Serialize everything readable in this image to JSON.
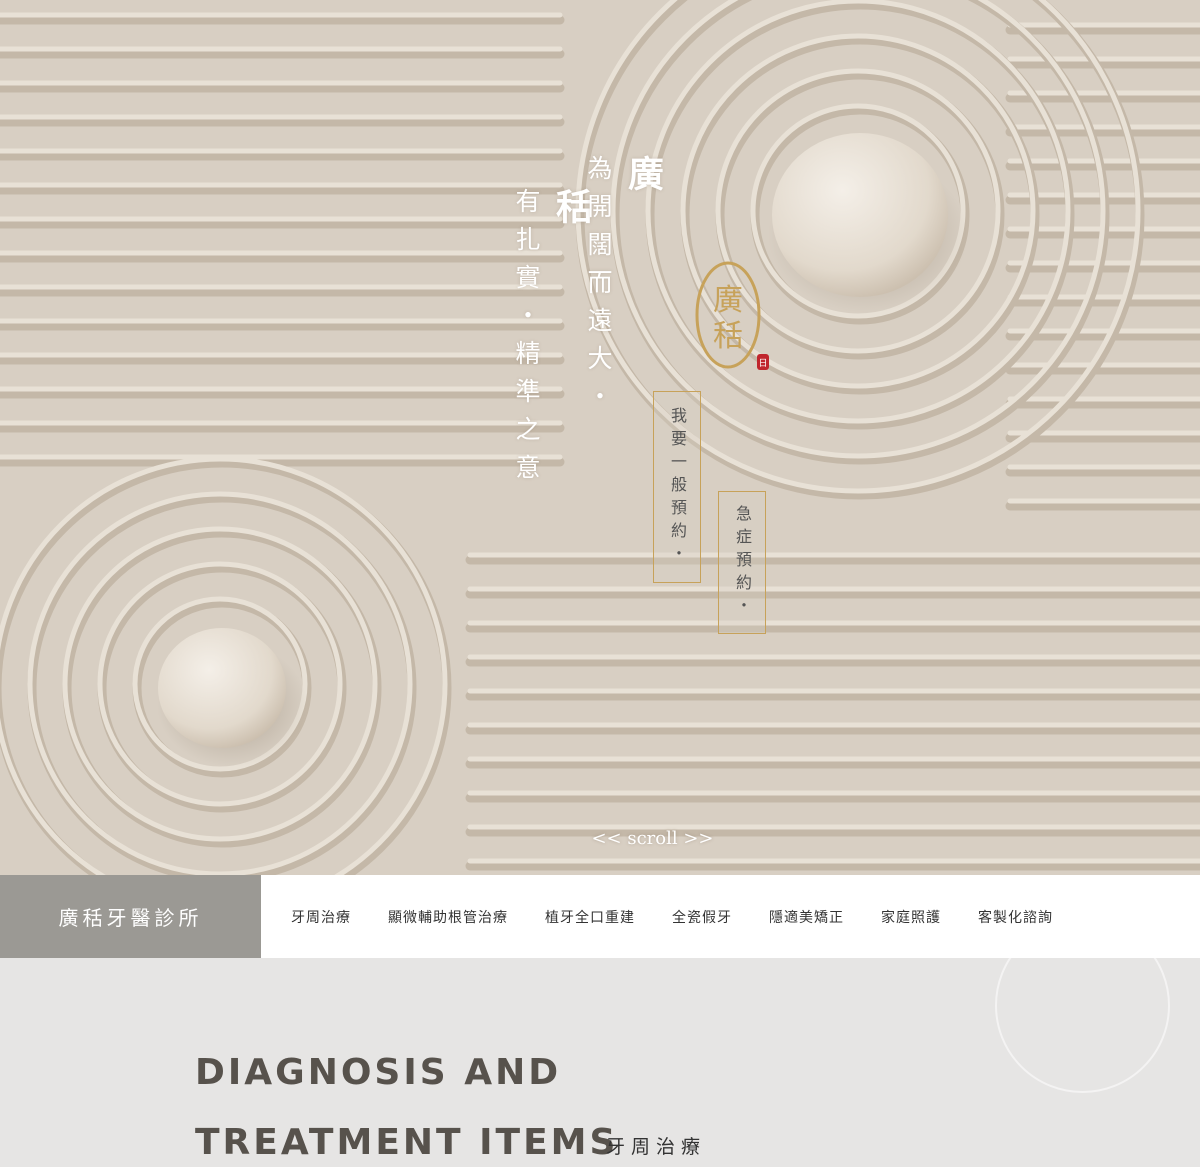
{
  "hero": {
    "line1_big": "秳",
    "line1_rest": "有扎實・精準之意",
    "line2_big": "廣",
    "line2_rest": "為開闊而遠大・",
    "seal_text": "廣秳",
    "seal_stamp": "日",
    "booking_general": "我要一般預約・",
    "booking_emergency": "急症預約・",
    "scroll_label": "<< scroll >>"
  },
  "nav": {
    "brand": "廣秳牙醫診所",
    "items": [
      "牙周治療",
      "顯微輔助根管治療",
      "植牙全口重建",
      "全瓷假牙",
      "隱適美矯正",
      "家庭照護",
      "客製化諮詢"
    ]
  },
  "section": {
    "heading_line1": "DIAGNOSIS AND",
    "heading_line2": "TREATMENT ITEMS",
    "subheading": "牙周治療"
  },
  "colors": {
    "sand": "#d8cfc3",
    "gold": "#c7a25a",
    "brand_bg": "#9b9994",
    "section_bg": "#e6e5e4"
  }
}
